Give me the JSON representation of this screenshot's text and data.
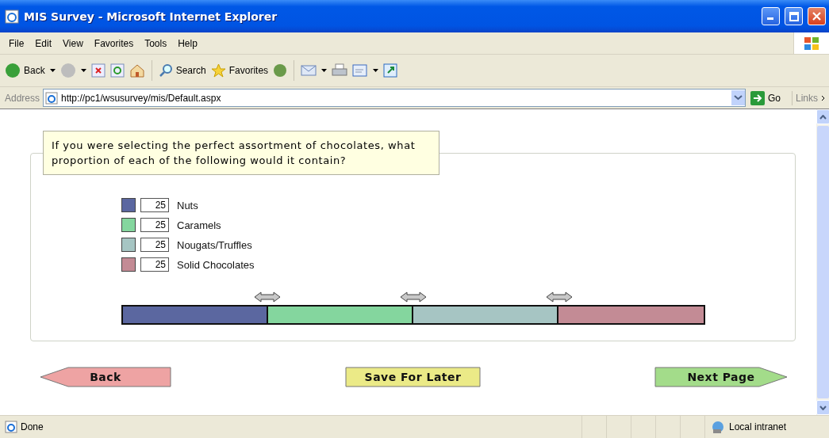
{
  "window": {
    "title": "MIS Survey - Microsoft Internet Explorer"
  },
  "menu": [
    "File",
    "Edit",
    "View",
    "Favorites",
    "Tools",
    "Help"
  ],
  "toolbar": {
    "back": "Back",
    "search": "Search",
    "favorites": "Favorites"
  },
  "address_bar": {
    "label": "Address",
    "url": "http://pc1/wsusurvey/mis/Default.aspx",
    "go": "Go",
    "links": "Links"
  },
  "question": {
    "text": "If you were selecting the perfect assortment of chocolates, what proportion of each of the following would it contain?",
    "items": [
      {
        "name": "Nuts",
        "value": "25",
        "color": "#5b67a0"
      },
      {
        "name": "Caramels",
        "value": "25",
        "color": "#84d69e"
      },
      {
        "name": "Nougats/Truffles",
        "value": "25",
        "color": "#a6c5c3"
      },
      {
        "name": "Solid Chocolates",
        "value": "25",
        "color": "#c38b95"
      }
    ]
  },
  "buttons": {
    "back": "Back",
    "save": "Save For Later",
    "next": "Next Page"
  },
  "status_bar": {
    "text": "Done",
    "zone": "Local intranet"
  }
}
